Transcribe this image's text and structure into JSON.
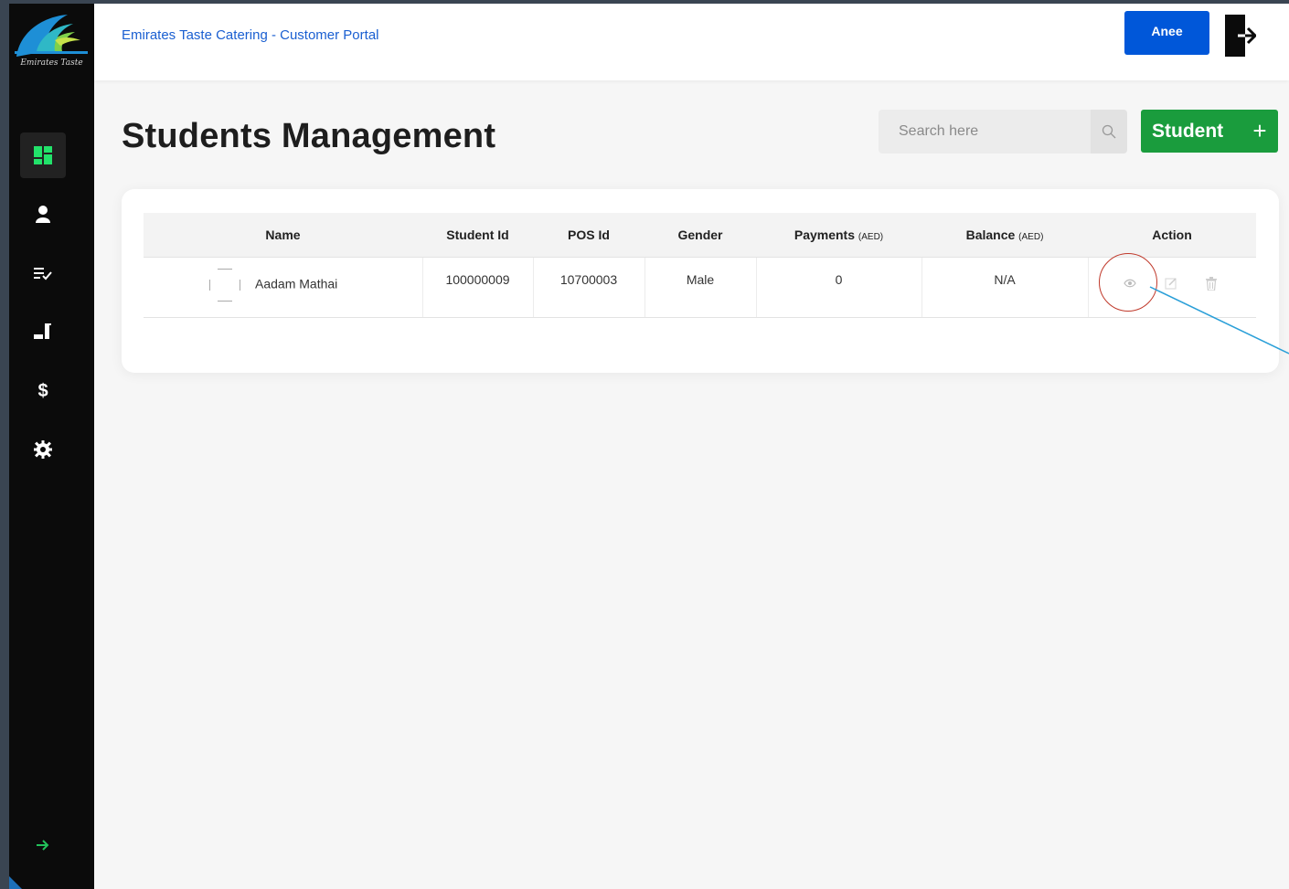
{
  "app": {
    "logo_text": "Emirates Taste",
    "portal_title": "Emirates Taste Catering - Customer Portal",
    "user_name": "Anee"
  },
  "sidebar": {
    "items": [
      {
        "icon": "dashboard-icon",
        "active": true
      },
      {
        "icon": "user-icon"
      },
      {
        "icon": "checklist-icon"
      },
      {
        "icon": "meal-icon"
      },
      {
        "icon": "dollar-icon",
        "glyph": "$"
      },
      {
        "icon": "gear-icon"
      }
    ],
    "expand_icon": "arrow-right-icon"
  },
  "page": {
    "title": "Students Management",
    "search_placeholder": "Search here",
    "add_button_label": "Student",
    "add_button_plus": "+"
  },
  "table": {
    "headers": {
      "name": "Name",
      "student_id": "Student Id",
      "pos_id": "POS Id",
      "gender": "Gender",
      "payments": "Payments",
      "payments_unit": "(AED)",
      "balance": "Balance",
      "balance_unit": "(AED)",
      "action": "Action"
    },
    "rows": [
      {
        "name": "Aadam Mathai",
        "student_id": "100000009",
        "pos_id": "10700003",
        "gender": "Male",
        "payments": "0",
        "balance": "N/A"
      }
    ]
  },
  "colors": {
    "sidebar_bg": "#0b0b0b",
    "brand_blue": "#0057d9",
    "accent_green": "#1a9c3d",
    "nav_active_green": "#22e26a",
    "annotation_red": "#c0392b",
    "annotation_blue": "#2a9fd8"
  }
}
